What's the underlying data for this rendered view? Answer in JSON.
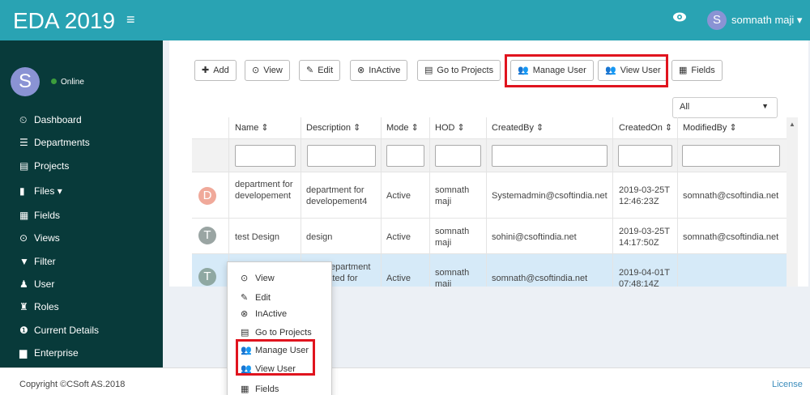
{
  "app": {
    "title": "EDA 2019",
    "username": "somnath maji",
    "avatar_letter": "S",
    "status": "Online"
  },
  "sidebar": {
    "items": [
      {
        "label": "Dashboard",
        "icon": "dashboard-icon"
      },
      {
        "label": "Departments",
        "icon": "list-icon"
      },
      {
        "label": "Projects",
        "icon": "projects-icon"
      },
      {
        "label": "Files",
        "icon": "file-icon",
        "caret": "▾"
      },
      {
        "label": "Fields",
        "icon": "fields-icon"
      },
      {
        "label": "Views",
        "icon": "view-icon"
      },
      {
        "label": "Filter",
        "icon": "filter-icon"
      },
      {
        "label": "User",
        "icon": "user-icon"
      },
      {
        "label": "Roles",
        "icon": "roles-icon"
      },
      {
        "label": "Current Details",
        "icon": "info-icon"
      },
      {
        "label": "Enterprise",
        "icon": "enterprise-icon"
      }
    ]
  },
  "toolbar": {
    "add": "Add",
    "view": "View",
    "edit": "Edit",
    "inactive": "InActive",
    "go_to_projects": "Go to Projects",
    "manage_user": "Manage User",
    "view_user": "View User",
    "fields": "Fields"
  },
  "filter_select": {
    "value": "All"
  },
  "table": {
    "columns": [
      "Name ⇕",
      "Description ⇕",
      "Mode ⇕",
      "HOD ⇕",
      "CreatedBy ⇕",
      "CreatedOn ⇕",
      "ModifiedBy ⇕"
    ],
    "rows": [
      {
        "initial": "D",
        "avatar_color": "#f0a99a",
        "name": "department for developement",
        "description": "department for developement4",
        "mode": "Active",
        "hod": "somnath maji",
        "created_by": "Systemadmin@csoftindia.net",
        "created_on": "2019-03-25T12:46:23Z",
        "modified_by": "somnath@csoftindia.net"
      },
      {
        "initial": "T",
        "avatar_color": "#9aa5a3",
        "name": "test Design",
        "description": "design",
        "mode": "Active",
        "hod": "somnath maji",
        "created_by": "sohini@csoftindia.net",
        "created_on": "2019-03-25T14:17:50Z",
        "modified_by": "somnath@csoftindia.net"
      },
      {
        "initial": "T",
        "avatar_color": "#8fa8a2",
        "name": "",
        "description": "This department is created for",
        "mode": "Active",
        "hod": "somnath maji",
        "created_by": "somnath@csoftindia.net",
        "created_on": "2019-04-01T07:48:14Z",
        "modified_by": ""
      }
    ]
  },
  "context_menu": {
    "items": [
      "View",
      "Edit",
      "InActive",
      "Go to Projects",
      "Manage User",
      "View User",
      "Fields"
    ]
  },
  "footer": {
    "copyright": "Copyright ©CSoft AS.2018",
    "license": "License"
  },
  "colors": {
    "topbar": "#29a3b3",
    "sidebar": "#083a3a",
    "highlight": "#e0141e",
    "selected_row": "#d6eaf8"
  }
}
